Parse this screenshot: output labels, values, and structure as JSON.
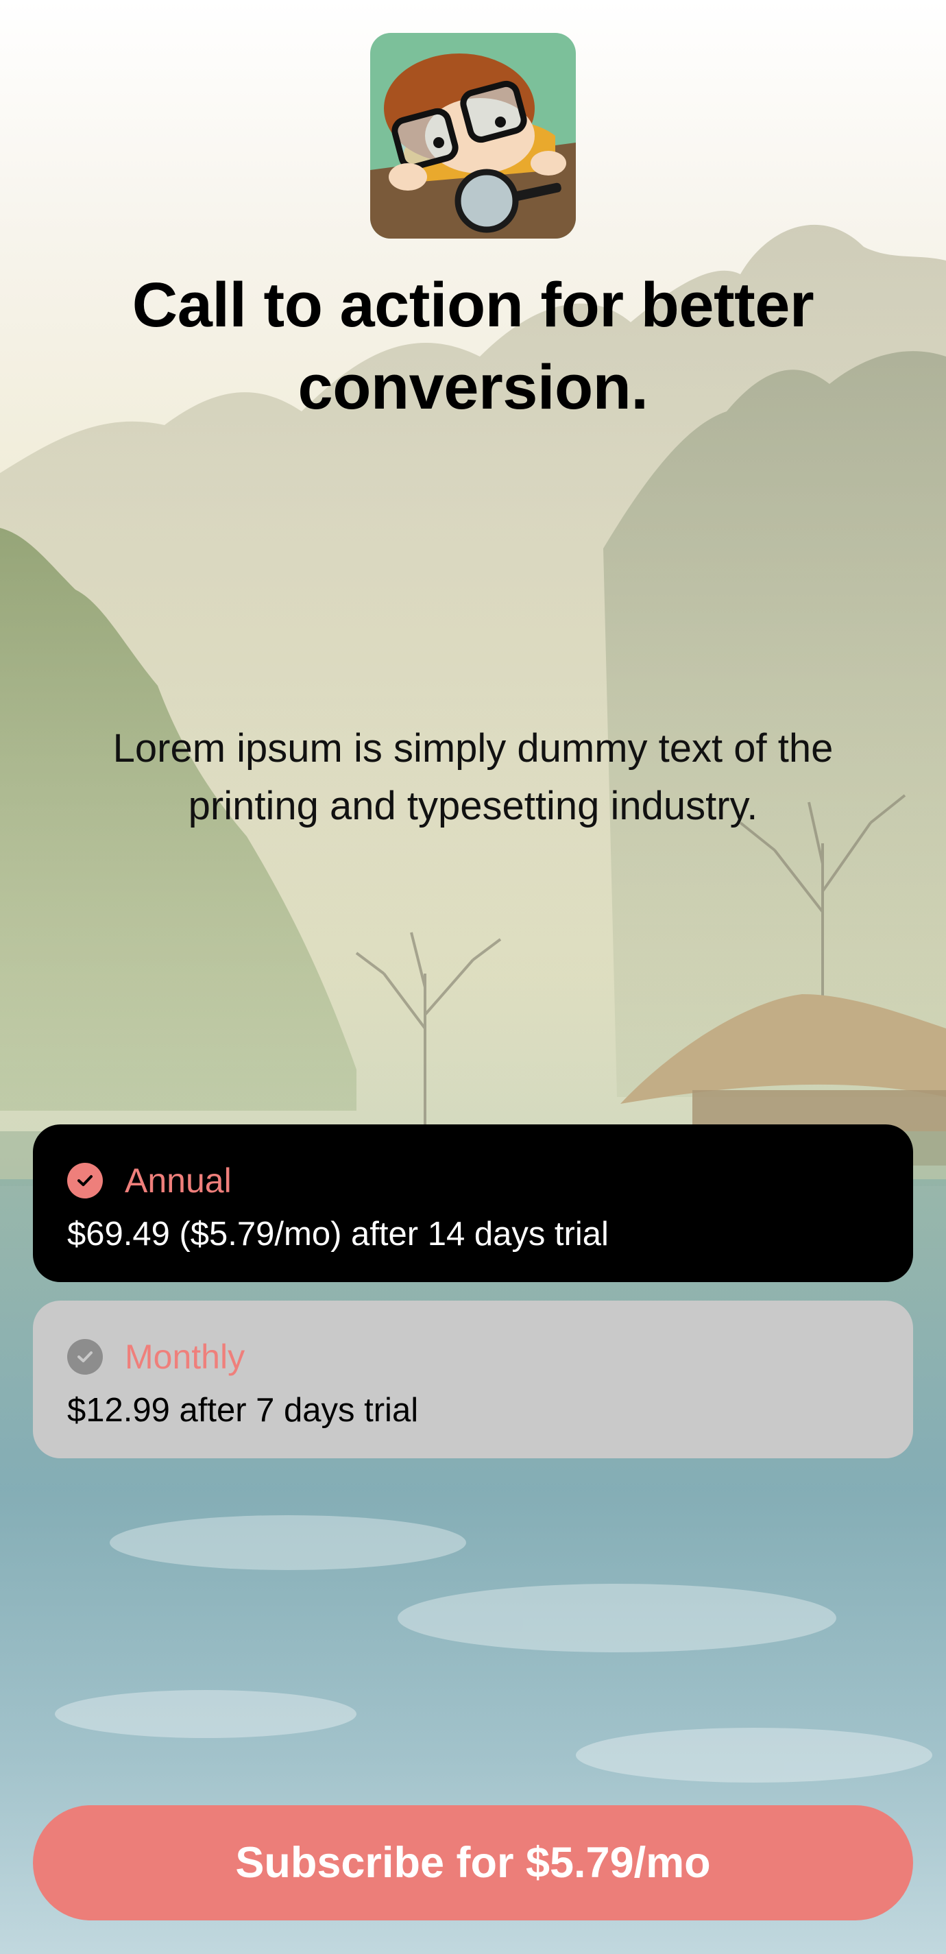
{
  "app_icon": {
    "icon": "boy-with-glasses-magnifier-icon"
  },
  "headline": "Call to action for better conversion.",
  "subtitle": "Lorem ipsum is simply dummy text of the printing and typesetting industry.",
  "plans": [
    {
      "name": "Annual",
      "price_text": "$69.49 ($5.79/mo) after 14 days trial",
      "selected": true
    },
    {
      "name": "Monthly",
      "price_text": "$12.99 after 7 days trial",
      "selected": false
    }
  ],
  "subscribe_button": {
    "label": "Subscribe for $5.79/mo"
  },
  "colors": {
    "accent": "#EC7E79",
    "selected_card": "#000000",
    "unselected_card": "#C9C9C9"
  }
}
